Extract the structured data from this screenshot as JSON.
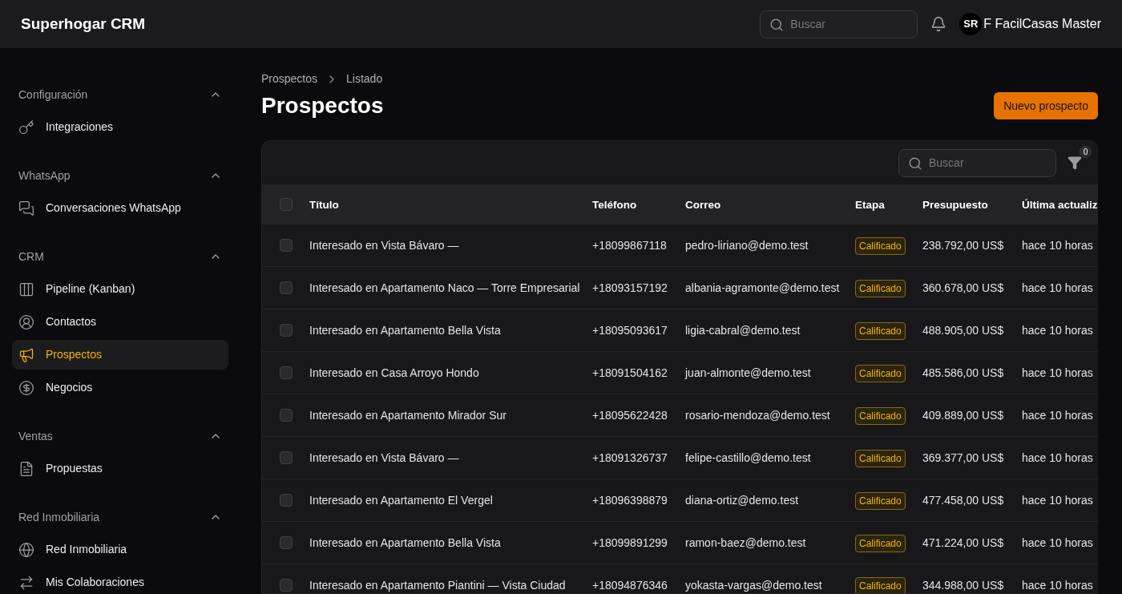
{
  "app_title": "Superhogar CRM",
  "header": {
    "search": {
      "placeholder": "Buscar"
    },
    "user": {
      "initials": "SR",
      "name": "F FacilCasas Master"
    }
  },
  "sidebar": {
    "sections": [
      {
        "label": "Configuración",
        "expanded": true,
        "items": [
          {
            "label": "Integraciones",
            "selected": false
          }
        ]
      },
      {
        "label": "WhatsApp",
        "expanded": true,
        "items": [
          {
            "label": "Conversaciones WhatsApp",
            "selected": false
          }
        ]
      },
      {
        "label": "CRM",
        "expanded": true,
        "items": [
          {
            "label": "Pipeline (Kanban)",
            "selected": false
          },
          {
            "label": "Contactos",
            "selected": false
          },
          {
            "label": "Prospectos",
            "selected": true
          },
          {
            "label": "Negocios",
            "selected": false
          }
        ]
      },
      {
        "label": "Ventas",
        "expanded": true,
        "items": [
          {
            "label": "Propuestas",
            "selected": false
          }
        ]
      },
      {
        "label": "Red Inmobiliaria",
        "expanded": true,
        "items": [
          {
            "label": "Red Inmobiliaria",
            "selected": false
          },
          {
            "label": "Mis Colaboraciones",
            "selected": false
          }
        ]
      }
    ]
  },
  "breadcrumb": [
    "Prospectos",
    "Listado"
  ],
  "page_title": "Prospectos",
  "new_button": "Nuevo prospecto",
  "table_search": {
    "placeholder": "Buscar"
  },
  "filter_count": "0",
  "table": {
    "select_all_checked": false,
    "columns": [
      "Título",
      "Teléfono",
      "Correo",
      "Etapa",
      "Presupuesto",
      "Última actualiz"
    ],
    "rows": [
      {
        "checked": false,
        "cells": [
          "Interesado en Vista Bávaro —",
          "+18099867118",
          "pedro-liriano@demo.test",
          "Calificado",
          "238.792,00 US$",
          "hace 10 horas"
        ]
      },
      {
        "checked": false,
        "cells": [
          "Interesado en Apartamento Naco — Torre Empresarial",
          "+18093157192",
          "albania-agramonte@demo.test",
          "Calificado",
          "360.678,00 US$",
          "hace 10 horas"
        ]
      },
      {
        "checked": false,
        "cells": [
          "Interesado en Apartamento Bella Vista",
          "+18095093617",
          "ligia-cabral@demo.test",
          "Calificado",
          "488.905,00 US$",
          "hace 10 horas"
        ]
      },
      {
        "checked": false,
        "cells": [
          "Interesado en Casa Arroyo Hondo",
          "+18091504162",
          "juan-almonte@demo.test",
          "Calificado",
          "485.586,00 US$",
          "hace 10 horas"
        ]
      },
      {
        "checked": false,
        "cells": [
          "Interesado en Apartamento Mirador Sur",
          "+18095622428",
          "rosario-mendoza@demo.test",
          "Calificado",
          "409.889,00 US$",
          "hace 10 horas"
        ]
      },
      {
        "checked": false,
        "cells": [
          "Interesado en Vista Bávaro —",
          "+18091326737",
          "felipe-castillo@demo.test",
          "Calificado",
          "369.377,00 US$",
          "hace 10 horas"
        ]
      },
      {
        "checked": false,
        "cells": [
          "Interesado en Apartamento El Vergel",
          "+18096398879",
          "diana-ortiz@demo.test",
          "Calificado",
          "477.458,00 US$",
          "hace 10 horas"
        ]
      },
      {
        "checked": false,
        "cells": [
          "Interesado en Apartamento Bella Vista",
          "+18099891299",
          "ramon-baez@demo.test",
          "Calificado",
          "471.224,00 US$",
          "hace 10 horas"
        ]
      },
      {
        "checked": false,
        "cells": [
          "Interesado en Apartamento Piantini — Vista Ciudad",
          "+18094876346",
          "yokasta-vargas@demo.test",
          "Calificado",
          "344.988,00 US$",
          "hace 10 horas"
        ]
      }
    ]
  }
}
